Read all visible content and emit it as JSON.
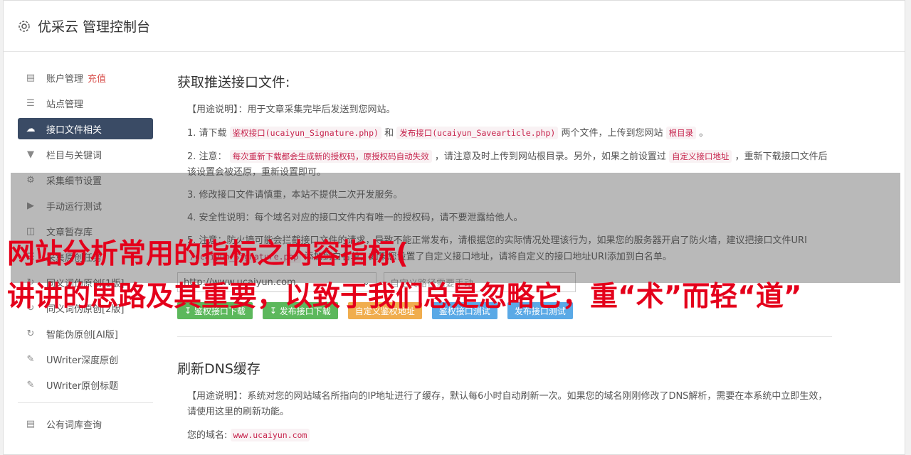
{
  "header": {
    "title": "优采云 管理控制台",
    "icon": "gear-icon"
  },
  "sidebar": {
    "items": [
      {
        "label": "账户管理",
        "extra": "充值",
        "icon": "bar-chart-icon"
      },
      {
        "label": "站点管理",
        "icon": "server-icon"
      },
      {
        "label": "接口文件相关",
        "icon": "cloud-upload-icon",
        "active": true
      },
      {
        "label": "栏目与关键词",
        "icon": "filter-icon"
      },
      {
        "label": "采集细节设置",
        "icon": "cogs-icon"
      },
      {
        "label": "手动运行测试",
        "icon": "play-icon"
      },
      {
        "label": "文章暂存库",
        "icon": "database-icon"
      },
      {
        "label": "采集原创任务",
        "icon": "tasks-icon"
      },
      {
        "label": "同义词伪原创[1版]",
        "icon": "refresh-icon"
      },
      {
        "label": "同义词伪原创[2版]",
        "icon": "refresh-icon"
      },
      {
        "label": "智能伪原创[AI版]",
        "icon": "refresh-icon"
      },
      {
        "label": "UWriter深度原创",
        "icon": "edit-icon"
      },
      {
        "label": "UWriter原创标题",
        "icon": "edit-icon"
      }
    ],
    "bottom_items": [
      {
        "label": "公有词库查询",
        "icon": "book-icon"
      }
    ]
  },
  "section1": {
    "title": "获取推送接口文件:",
    "usage": "【用途说明】：用于文章采集完毕后发送到您网站。",
    "step1": {
      "pre": "1. 请下载",
      "code1": "鉴权接口(ucaiyun_Signature.php)",
      "mid": "和",
      "code2": "发布接口(ucaiyun_Savearticle.php)",
      "post": "两个文件，上传到您网站",
      "code3": "根目录",
      "end": "。"
    },
    "step2": {
      "pre": "2. 注意：",
      "code1": "每次重新下载都会生成新的授权码，原授权码自动失效",
      "mid": "，请注意及时上传到网站根目录。另外，如果之前设置过",
      "code2": "自定义接口地址",
      "post": "，重新下载接口文件后该设置会被还原，重新设置即可。"
    },
    "step3": "3. 修改接口文件请慎重，本站不提供二次开发服务。",
    "step4": "4. 安全性说明：每个域名对应的接口文件内有唯一的授权码，请不要泄露给他人。",
    "step5": {
      "pre": "5. 注意：防火墙可能会拦截接口文件的请求，导致不能正常发布，请根据您的实际情况处理该行为，如果您的服务器开启了防火墙，建议把接口文件URI",
      "code1": "/ucaiyun_Signature.php",
      "post": "添加到白名单，如果您设置了自定义接口地址，请将自定义的接口地址URI添加到白名单。"
    },
    "select_value": "http://www.ucaiyun.com",
    "input_placeholder": "自定义路径需要手动",
    "buttons": {
      "b1": "鉴权接口下载",
      "b2": "发布接口下载",
      "b3": "自定义鉴权地址",
      "b4": "鉴权接口测试",
      "b5": "发布接口测试"
    }
  },
  "section2": {
    "title": "刷新DNS缓存",
    "usage": "【用途说明】：系统对您的网站域名所指向的IP地址进行了缓存，默认每6小时自动刷新一次。如果您的域名刚刚修改了DNS解析，需要在本系统中立即生效，请使用这里的刷新功能。",
    "domain_label": "您的域名:",
    "domain_value": "www.ucaiyun.com"
  },
  "overlay": {
    "line1": "网站分析常用的指标之内容指标(",
    "line2": "讲讲的思路及其重要，以致于我们总是忽略它，重“术”而轻“道”"
  },
  "colors": {
    "sidebar_active": "#3a4b65",
    "overlay_text": "#e4001b",
    "btn_green": "#5cb85c",
    "btn_orange": "#f0ad4e",
    "btn_blue": "#5aa9e6"
  }
}
